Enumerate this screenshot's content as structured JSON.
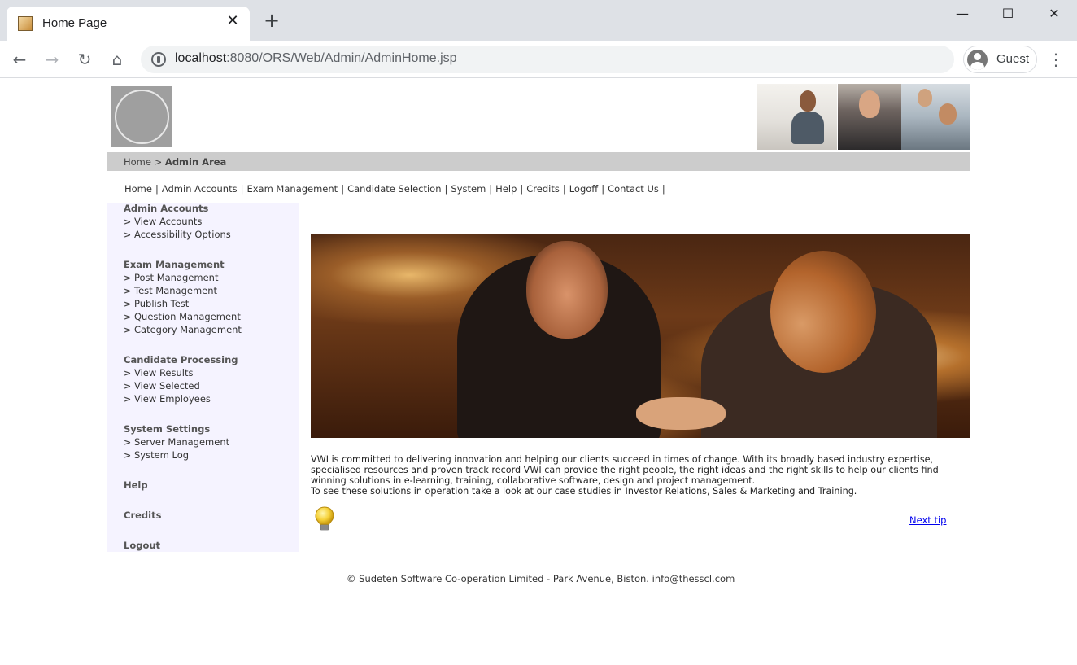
{
  "browser": {
    "tab_title": "Home Page",
    "tab_close": "✕",
    "new_tab": "+",
    "url_host": "localhost",
    "url_rest": ":8080/ORS/Web/Admin/AdminHome.jsp",
    "profile_name": "Guest",
    "window_controls": {
      "minimize": "—",
      "maximize": "☐",
      "close": "✕"
    },
    "nav": {
      "back": "←",
      "forward": "→",
      "reload": "↻",
      "home": "⌂",
      "menu": "⋮"
    }
  },
  "breadcrumb": {
    "home": "Home",
    "separator": ">",
    "current": "Admin Area"
  },
  "topnav": [
    "Home",
    "Admin Accounts",
    "Exam Management",
    "Candidate Selection",
    "System",
    "Help",
    "Credits",
    "Logoff",
    "Contact Us"
  ],
  "topnav_separator": "|",
  "sidebar": {
    "admin_accounts": {
      "heading": "Admin Accounts",
      "items": [
        "View Accounts",
        "Accessibility Options"
      ]
    },
    "exam_management": {
      "heading": "Exam Management",
      "items": [
        "Post Management",
        "Test Management",
        "Publish Test",
        "Question Management",
        "Category Management"
      ]
    },
    "candidate_processing": {
      "heading": "Candidate Processing",
      "items": [
        "View Results",
        "View Selected",
        "View Employees"
      ]
    },
    "system_settings": {
      "heading": "System Settings",
      "items": [
        "Server Management",
        "System Log"
      ]
    },
    "help": "Help",
    "credits": "Credits",
    "logout": "Logout",
    "chevron": ">"
  },
  "intro": {
    "p1": "VWI is committed to delivering innovation and helping our clients succeed in times of change. With its broadly based industry expertise, specialised resources and proven track record VWI can provide the right people, the right ideas and the right skills to help our clients find winning solutions in e-learning, training, collaborative software, design and project management.",
    "p2": "To see these solutions in operation take a look at our case studies in Investor Relations, Sales & Marketing and Training."
  },
  "tip": {
    "next_label": "Next tip",
    "icon": "lightbulb-icon"
  },
  "footer": "© Sudeten Software Co-operation Limited - Park Avenue, Biston. info@thesscl.com",
  "colors": {
    "sidebar_bg": "#f5f3ff",
    "crumb_bar": "#cccccc",
    "link": "#0000ee"
  }
}
